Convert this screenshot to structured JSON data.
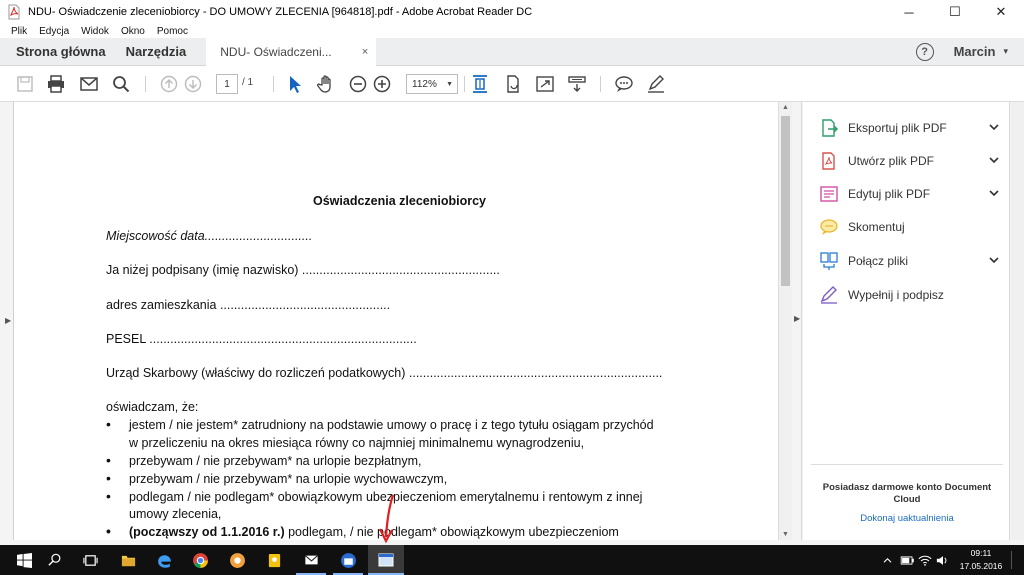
{
  "window": {
    "title": "NDU- Oświadczenie zleceniobiorcy - DO UMOWY ZLECENIA [964818].pdf - Adobe Acrobat Reader DC",
    "minimize": "─",
    "maximize": "☐",
    "close": "✕"
  },
  "menu": [
    "Plik",
    "Edycja",
    "Widok",
    "Okno",
    "Pomoc"
  ],
  "tabs": {
    "home": "Strona główna",
    "tools": "Narzędzia",
    "doc": "NDU- Oświadczeni...",
    "doc_close": "×",
    "help": "?",
    "user": "Marcin",
    "user_caret": "▾"
  },
  "toolbar": {
    "page_current": "1",
    "page_total": "/ 1",
    "zoom": "112%",
    "zoom_caret": "▼"
  },
  "document": {
    "title": "Oświadczenia zleceniobiorcy",
    "line_place": "Miejscowość data...............................",
    "line_name": "Ja niżej podpisany (imię nazwisko) .........................................................",
    "line_address": "adres zamieszkania .................................................",
    "line_pesel": "PESEL .............................................................................",
    "line_tax": "Urząd Skarbowy (właściwy do rozliczeń podatkowych) .........................................................................",
    "line_declare": "oświadczam, że:",
    "bullet_1a": "jestem / nie jestem* zatrudniony na podstawie umowy o pracę i z tego tytułu osiągam przychód",
    "bullet_1b": "w przeliczeniu na okres miesiąca równy co najmniej minimalnemu wynagrodzeniu,",
    "bullet_2": "przebywam  / nie przebywam* na urlopie bezpłatnym,",
    "bullet_3": "przebywam / nie przebywam* na urlopie wychowawczym,",
    "bullet_4a": "podlegam / nie podlegam* obowiązkowym ubezpieczeniom emerytalnemu i rentowym z innej",
    "bullet_4b": "umowy zlecenia,",
    "bullet_5_bold": "(począwszy od 1.1.2016 r.)",
    "bullet_5_rest": " podlegam, / nie podlegam* obowiązkowym ubezpieczeniom",
    "bullet_symbol": "•"
  },
  "right_panel": {
    "items": [
      {
        "label": "Eksportuj plik PDF",
        "icon": "export-pdf-icon",
        "has_chevron": true
      },
      {
        "label": "Utwórz plik PDF",
        "icon": "create-pdf-icon",
        "has_chevron": true
      },
      {
        "label": "Edytuj plik PDF",
        "icon": "edit-pdf-icon",
        "has_chevron": true
      },
      {
        "label": "Skomentuj",
        "icon": "comment-icon",
        "has_chevron": false
      },
      {
        "label": "Połącz pliki",
        "icon": "combine-files-icon",
        "has_chevron": true
      },
      {
        "label": "Wypełnij i podpisz",
        "icon": "fill-sign-icon",
        "has_chevron": false
      }
    ],
    "chevron": "⌄",
    "promo": "Posiadasz darmowe konto Document Cloud",
    "link": "Dokonaj uaktualnienia"
  },
  "taskbar": {
    "time": "09:11",
    "date": "17.05.2016"
  },
  "colors": {
    "accent_blue": "#1a6bc4",
    "pdf_red": "#d92b2b",
    "doc_bg": "#dfe0e2"
  }
}
